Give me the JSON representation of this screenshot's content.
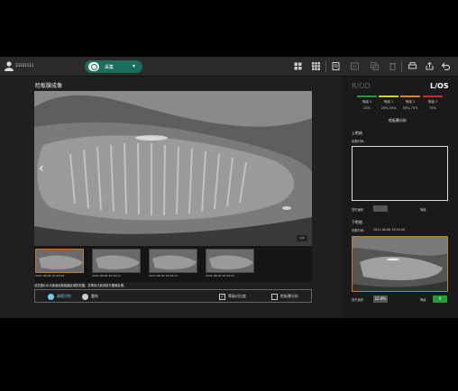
{
  "topbar": {
    "user_id": "33331111",
    "capture_label": "采集",
    "icons": [
      "layout-icon",
      "grid-icon",
      "report-icon",
      "compare-icon",
      "copy-icon",
      "trash-icon",
      "print-icon",
      "export-icon",
      "back-icon"
    ]
  },
  "left": {
    "title": "睑板腺成像",
    "zoom": "1/4",
    "thumbnails": [
      {
        "time": "2021-08-06 19:44:09",
        "selected": true
      },
      {
        "time": "2021-08-06 19:44:11",
        "selected": false
      },
      {
        "time": "2021-08-06 19:44:12",
        "selected": false
      },
      {
        "time": "2021-08-06 19:44:13",
        "selected": false
      }
    ],
    "hint": "请在图片中大致画出睑板腺区域的范围，并等待几秒钟进行图像处理。",
    "bottombar": {
      "draw_label": "画框识别",
      "clear_label": "重绘",
      "gradeview_label": "等级对比度",
      "analysis_label": "睑板腺分析"
    }
  },
  "right": {
    "eye_right": "R/OD",
    "eye_left": "L/OS",
    "grades": [
      {
        "name": "等级 0",
        "range": "25%",
        "color": "#2a9a35"
      },
      {
        "name": "等级 1",
        "range": "25%-50%",
        "color": "#d9d12a"
      },
      {
        "name": "等级 2",
        "range": "50%-75%",
        "color": "#d98a2a"
      },
      {
        "name": "等级 3",
        "range": "75%",
        "color": "#c93030"
      }
    ],
    "panel_title": "睑板腺分析",
    "upper": {
      "label": "上睑结",
      "time_label": "采集时间：",
      "loss_label": "损失面积",
      "grade_label": "等级"
    },
    "lower": {
      "label": "下睑结",
      "time_label": "采集时间：",
      "time": "2021-08-06 19:44:09",
      "loss_label": "损失面积",
      "loss_value": "12.8%",
      "grade_label": "等级",
      "grade_value": "0"
    }
  }
}
